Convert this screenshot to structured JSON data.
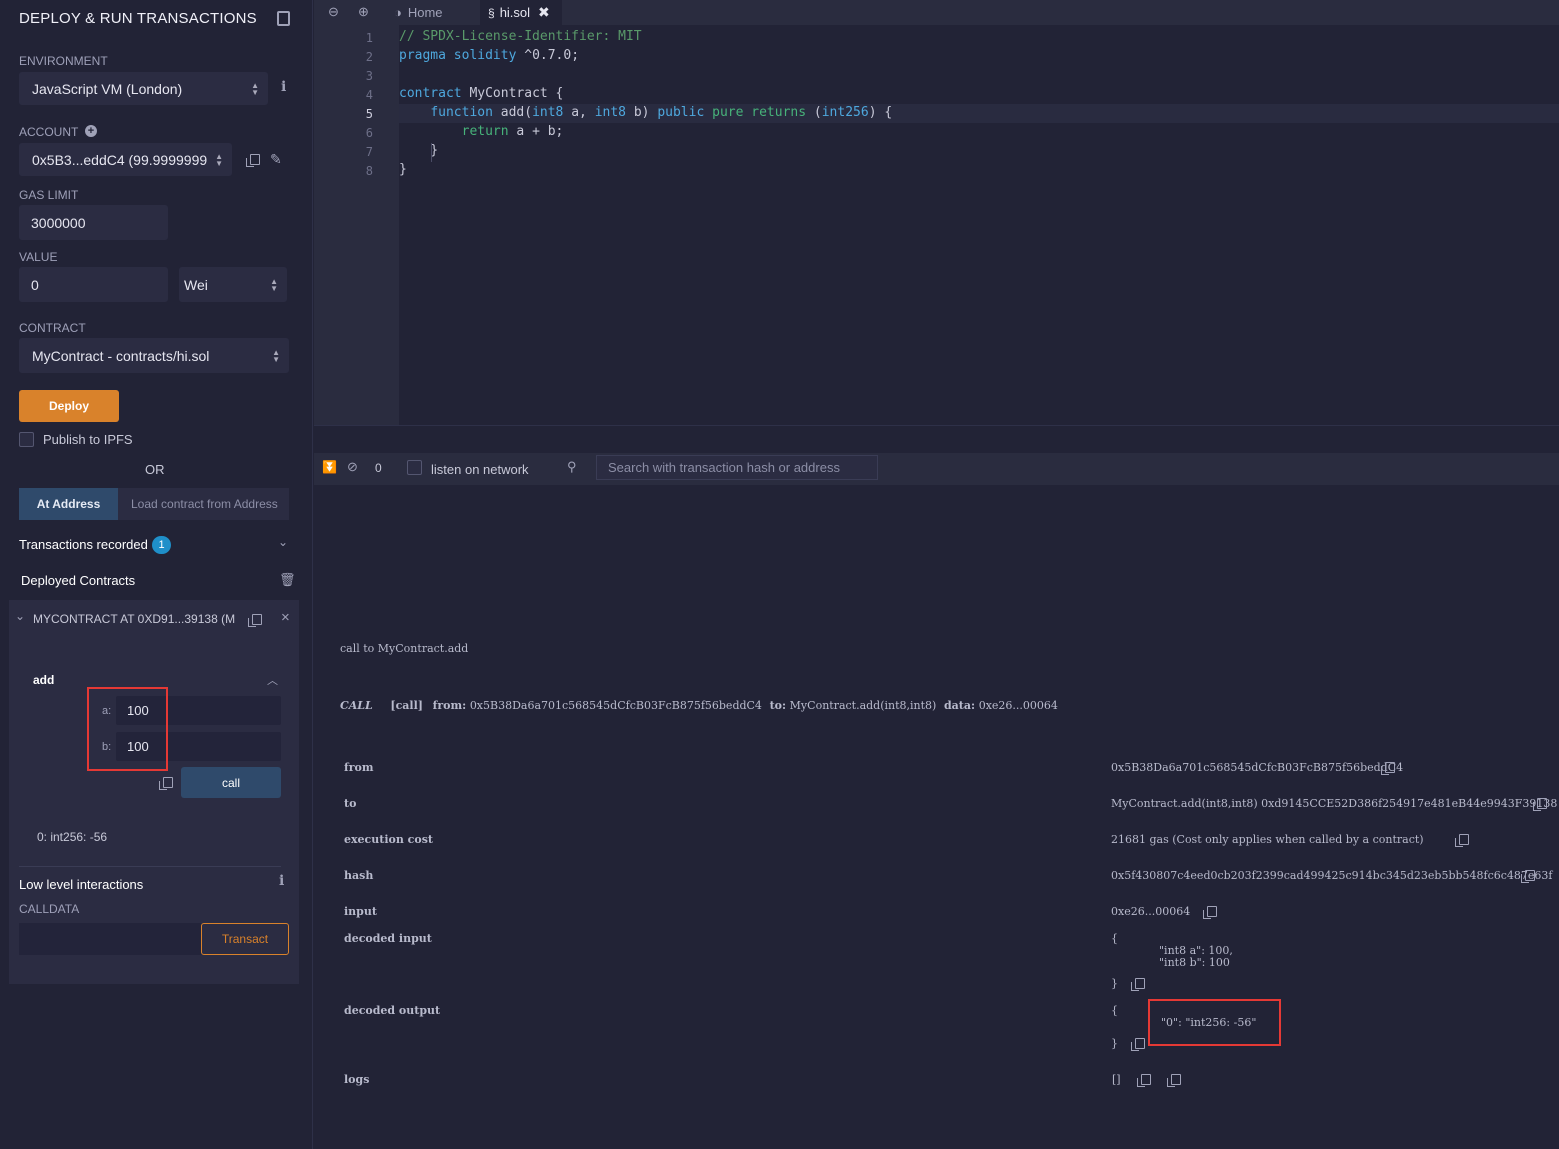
{
  "left": {
    "title": "DEPLOY & RUN TRANSACTIONS",
    "environment_label": "ENVIRONMENT",
    "environment_value": "JavaScript VM (London)",
    "account_label": "ACCOUNT",
    "account_value": "0x5B3...eddC4 (99.9999999",
    "gas_limit_label": "GAS LIMIT",
    "gas_limit_value": "3000000",
    "value_label": "VALUE",
    "value_value": "0",
    "value_unit": "Wei",
    "contract_label": "CONTRACT",
    "contract_value": "MyContract - contracts/hi.sol",
    "deploy_label": "Deploy",
    "publish_label": "Publish to IPFS",
    "or_label": "OR",
    "at_address_label": "At Address",
    "load_address_placeholder": "Load contract from Address",
    "transactions_recorded_label": "Transactions recorded",
    "transactions_recorded_count": "1",
    "deployed_contracts_label": "Deployed Contracts",
    "instance_title": "MYCONTRACT AT 0XD91...39138 (M",
    "function_name": "add",
    "param_a_label": "a:",
    "param_a_value": "100",
    "param_b_label": "b:",
    "param_b_value": "100",
    "call_label": "call",
    "result": "0: int256: -56",
    "low_level_label": "Low level interactions",
    "calldata_label": "CALLDATA",
    "transact_label": "Transact"
  },
  "editor": {
    "tabs": [
      {
        "label": "Home"
      },
      {
        "label": "hi.sol"
      }
    ],
    "line_numbers": [
      "1",
      "2",
      "3",
      "4",
      "5",
      "6",
      "7",
      "8"
    ],
    "lines": [
      "// SPDX-License-Identifier: MIT",
      "pragma solidity ^0.7.0;",
      "",
      "contract MyContract {",
      "    function add(int8 a, int8 b) public pure returns (int256) {",
      "        return a + b;",
      "    }",
      "}"
    ]
  },
  "terminal": {
    "pending_count": "0",
    "listen_label": "listen on network",
    "search_placeholder": "Search with transaction hash or address",
    "call_header": "call to MyContract.add",
    "call_tag": "CALL",
    "call_kind": "[call]",
    "from_key": "from:",
    "from_value": "0x5B38Da6a701c568545dCfcB03FcB875f56beddC4",
    "to_key": "to:",
    "to_value": "MyContract.add(int8,int8)",
    "data_key": "data:",
    "data_value": "0xe26...00064",
    "details": [
      {
        "key": "from",
        "value": "0x5B38Da6a701c568545dCfcB03FcB875f56beddC4"
      },
      {
        "key": "to",
        "value": "MyContract.add(int8,int8) 0xd9145CCE52D386f254917e481eB44e9943F39138"
      },
      {
        "key": "execution cost",
        "value": "21681 gas (Cost only applies when called by a contract)"
      },
      {
        "key": "hash",
        "value": "0x5f430807c4eed0cb203f2399cad499425c914bc345d23eb5bb548fc6c487e63f"
      },
      {
        "key": "input",
        "value": "0xe26...00064"
      }
    ],
    "decoded_input_key": "decoded input",
    "decoded_input_open": "{",
    "decoded_input_line1": "\"int8 a\": 100,",
    "decoded_input_line2": "\"int8 b\": 100",
    "decoded_input_close": "}",
    "decoded_output_key": "decoded output",
    "decoded_output_open": "{",
    "decoded_output_line": "\"0\": \"int256: -56\"",
    "decoded_output_close": "}",
    "logs_key": "logs",
    "logs_value": "[]"
  },
  "colors": {
    "accent_orange": "#d9822b",
    "button_blue": "#2f4a6b",
    "highlight_red": "#e53935",
    "badge_blue": "#1f8fc9"
  }
}
